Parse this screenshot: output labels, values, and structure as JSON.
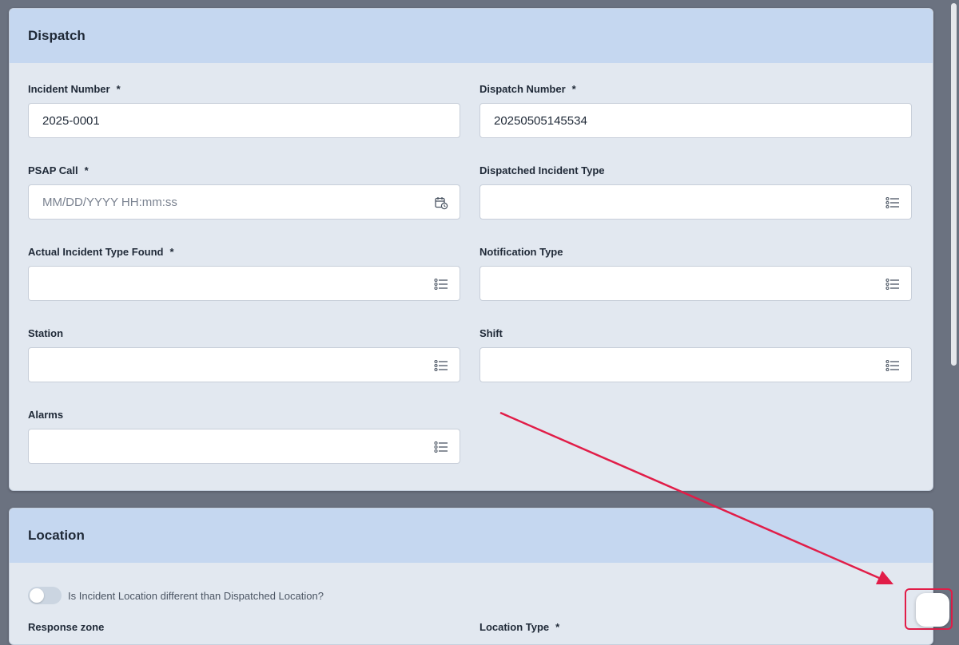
{
  "dispatch": {
    "title": "Dispatch",
    "fields": {
      "incident_number": {
        "label": "Incident Number",
        "required": "*",
        "value": "2025-0001"
      },
      "dispatch_number": {
        "label": "Dispatch Number",
        "required": "*",
        "value": "20250505145534"
      },
      "psap_call": {
        "label": "PSAP Call",
        "required": "*",
        "placeholder": "MM/DD/YYYY HH:mm:ss",
        "icon": "calendar-clock-icon"
      },
      "dispatched_incident_type": {
        "label": "Dispatched Incident Type",
        "value": "",
        "icon": "list-icon"
      },
      "actual_incident_type": {
        "label": "Actual Incident Type Found",
        "required": "*",
        "value": "",
        "icon": "list-icon"
      },
      "notification_type": {
        "label": "Notification Type",
        "value": "",
        "icon": "list-icon"
      },
      "station": {
        "label": "Station",
        "value": "",
        "icon": "list-icon"
      },
      "shift": {
        "label": "Shift",
        "value": "",
        "icon": "list-icon"
      },
      "alarms": {
        "label": "Alarms",
        "value": "",
        "icon": "list-icon"
      }
    }
  },
  "location": {
    "title": "Location",
    "toggle": {
      "label": "Is Incident Location different than Dispatched Location?",
      "on": false
    },
    "fields": {
      "response_zone": {
        "label": "Response zone"
      },
      "location_type": {
        "label": "Location Type",
        "required": "*"
      }
    }
  },
  "voice_button": {
    "icon": "voice-waveform-icon"
  },
  "colors": {
    "header": "#c5d7f0",
    "card": "#e2e8f0",
    "backdrop": "#6b7280",
    "annotation": "#e11d48"
  }
}
